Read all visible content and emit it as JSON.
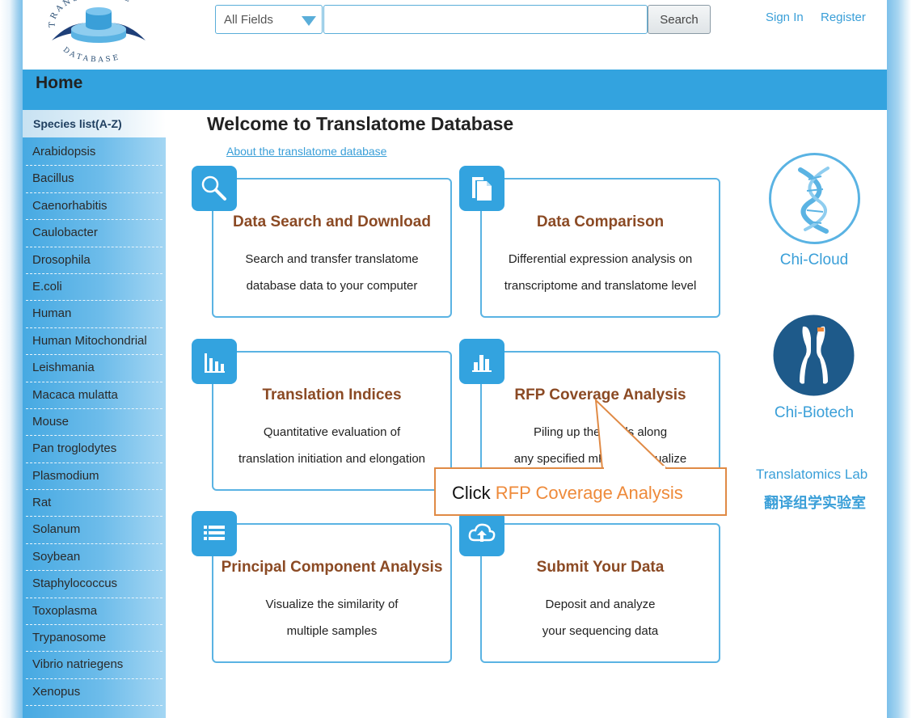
{
  "header": {
    "search_field_select": "All Fields",
    "search_placeholder": "",
    "search_button": "Search",
    "sign_in": "Sign In",
    "register": "Register"
  },
  "logo": {
    "top_text": "TRANSLATOME",
    "bottom_text": "DATABASE"
  },
  "nav": {
    "home": "Home"
  },
  "sidebar": {
    "heading": "Species list(A-Z)",
    "items": [
      "Arabidopsis",
      "Bacillus",
      "Caenorhabitis",
      "Caulobacter",
      "Drosophila",
      "E.coli",
      "Human",
      "Human Mitochondrial",
      "Leishmania",
      "Macaca mulatta",
      "Mouse",
      "Pan troglodytes",
      "Plasmodium",
      "Rat",
      "Solanum",
      "Soybean",
      "Staphylococcus",
      "Toxoplasma",
      "Trypanosome",
      "Vibrio natriegens",
      "Xenopus"
    ]
  },
  "main": {
    "welcome": "Welcome to Translatome Database",
    "about_link": "About the translatome database",
    "cards": [
      {
        "title": "Data Search and Download",
        "line1": "Search and transfer translatome",
        "line2": "database data to your computer",
        "icon": "search-icon"
      },
      {
        "title": "Data Comparison",
        "line1": "Differential expression analysis on",
        "line2": "transcriptome and translatome level",
        "icon": "document-icon"
      },
      {
        "title": "Translation Indices",
        "line1": "Quantitative evaluation of",
        "line2": "translation initiation and elongation",
        "icon": "bar-chart-icon"
      },
      {
        "title": "RFP Coverage Analysis",
        "line1": "Piling up the reads along",
        "line2": "any specified mRNA to visualize",
        "icon": "column-chart-icon"
      },
      {
        "title": "Principal Component Analysis",
        "line1": "Visualize the similarity of",
        "line2": "multiple samples",
        "icon": "list-icon"
      },
      {
        "title": "Submit Your Data",
        "line1": "Deposit and analyze",
        "line2": "your sequencing data",
        "icon": "cloud-upload-icon"
      }
    ]
  },
  "right_panel": {
    "chi_cloud": "Chi-Cloud",
    "chi_biotech": "Chi-Biotech",
    "lab_en": "Translatomics Lab",
    "lab_cn": "翻译组学实验室"
  },
  "callout": {
    "prefix": "Click ",
    "highlight": "RFP Coverage Analysis"
  },
  "colors": {
    "primary_blue": "#33a3df",
    "title_brown": "#8b4a24",
    "callout_orange": "#e08a45"
  }
}
